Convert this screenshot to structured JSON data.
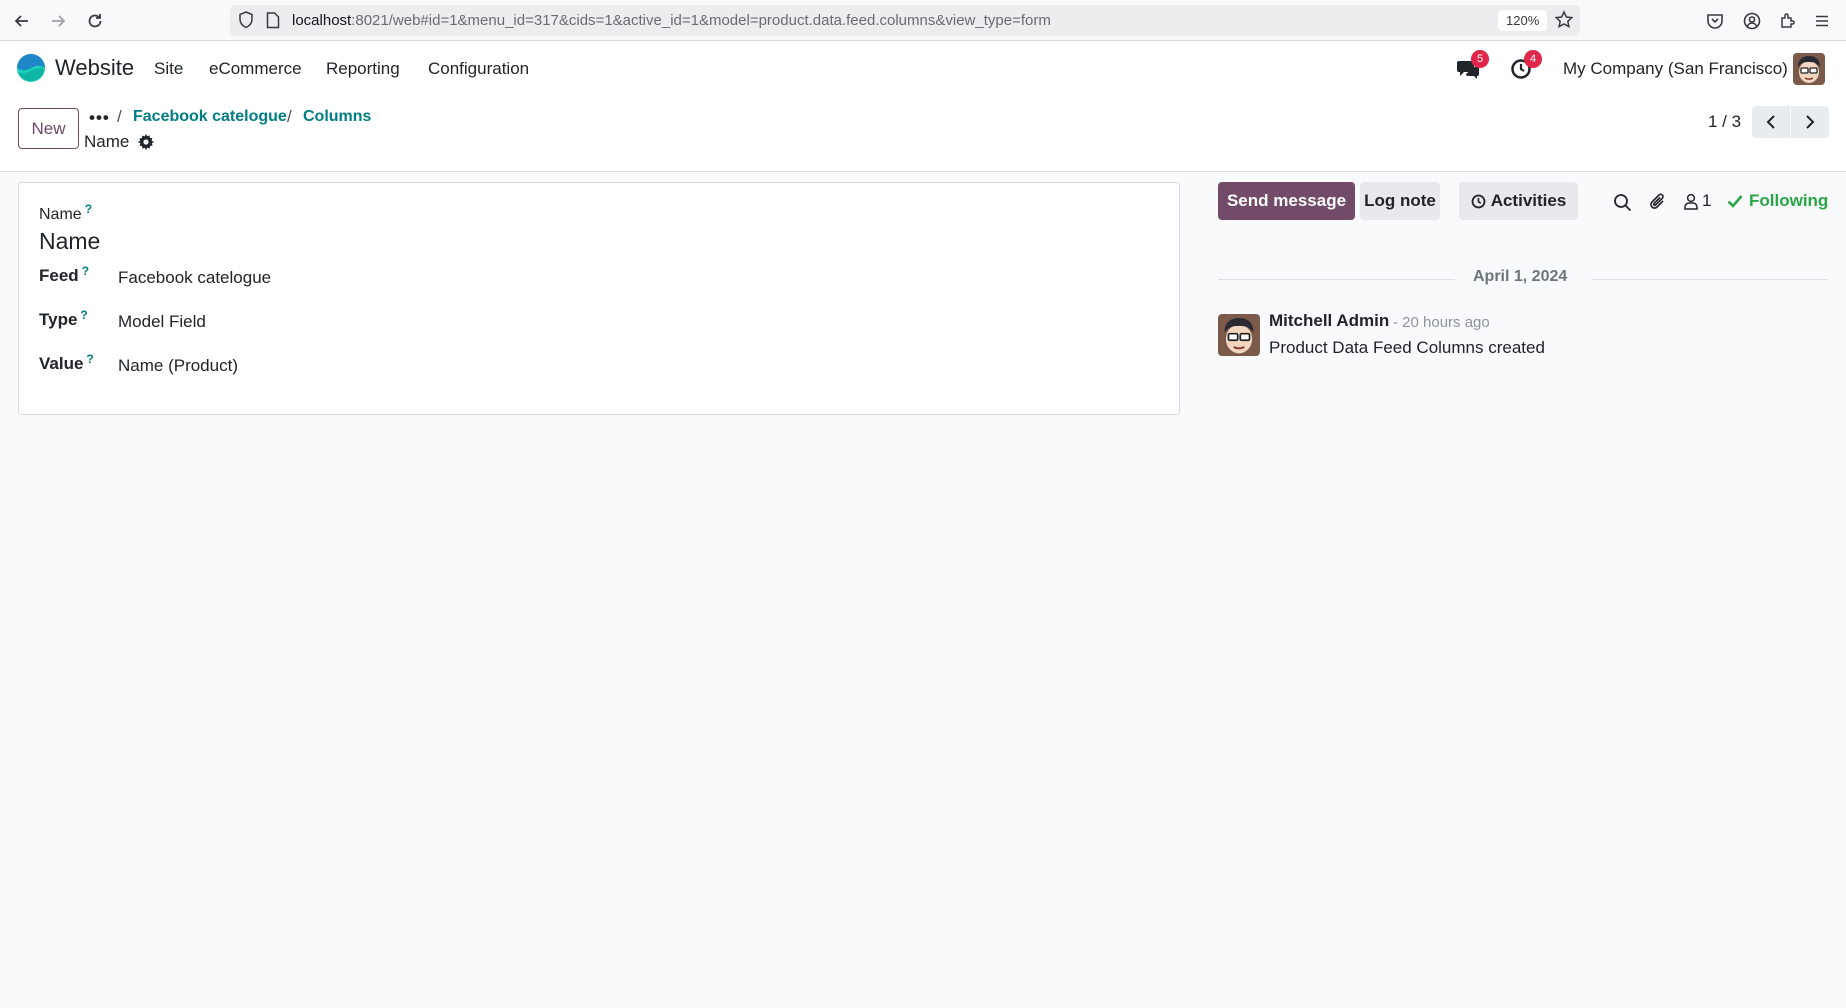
{
  "browser": {
    "url_host": "localhost",
    "url_rest": ":8021/web#id=1&menu_id=317&cids=1&active_id=1&model=product.data.feed.columns&view_type=form",
    "zoom": "120%"
  },
  "navbar": {
    "app_name": "Website",
    "menu": [
      "Site",
      "eCommerce",
      "Reporting",
      "Configuration"
    ],
    "messages_badge": "5",
    "activities_badge": "4",
    "company": "My Company (San Francisco)"
  },
  "control_panel": {
    "new_label": "New",
    "dots": "•••",
    "breadcrumb": [
      "Facebook catelogue",
      "Columns"
    ],
    "record_name": "Name",
    "pager": "1 / 3"
  },
  "form": {
    "name_label": "Name",
    "name_value": "Name",
    "feed_label": "Feed",
    "feed_value": "Facebook catelogue",
    "type_label": "Type",
    "type_value": "Model Field",
    "value_label": "Value",
    "value_value": "Name (Product)",
    "help_mark": "?"
  },
  "chatter": {
    "send_message": "Send message",
    "log_note": "Log note",
    "activities": "Activities",
    "followers_count": "1",
    "following": "Following",
    "date": "April 1, 2024",
    "author": "Mitchell Admin",
    "time": "- 20 hours ago",
    "body": "Product Data Feed Columns created"
  },
  "colors": {
    "brand": "#714b67",
    "link": "#017e84",
    "following": "#28a745",
    "badge": "#e0264a"
  }
}
